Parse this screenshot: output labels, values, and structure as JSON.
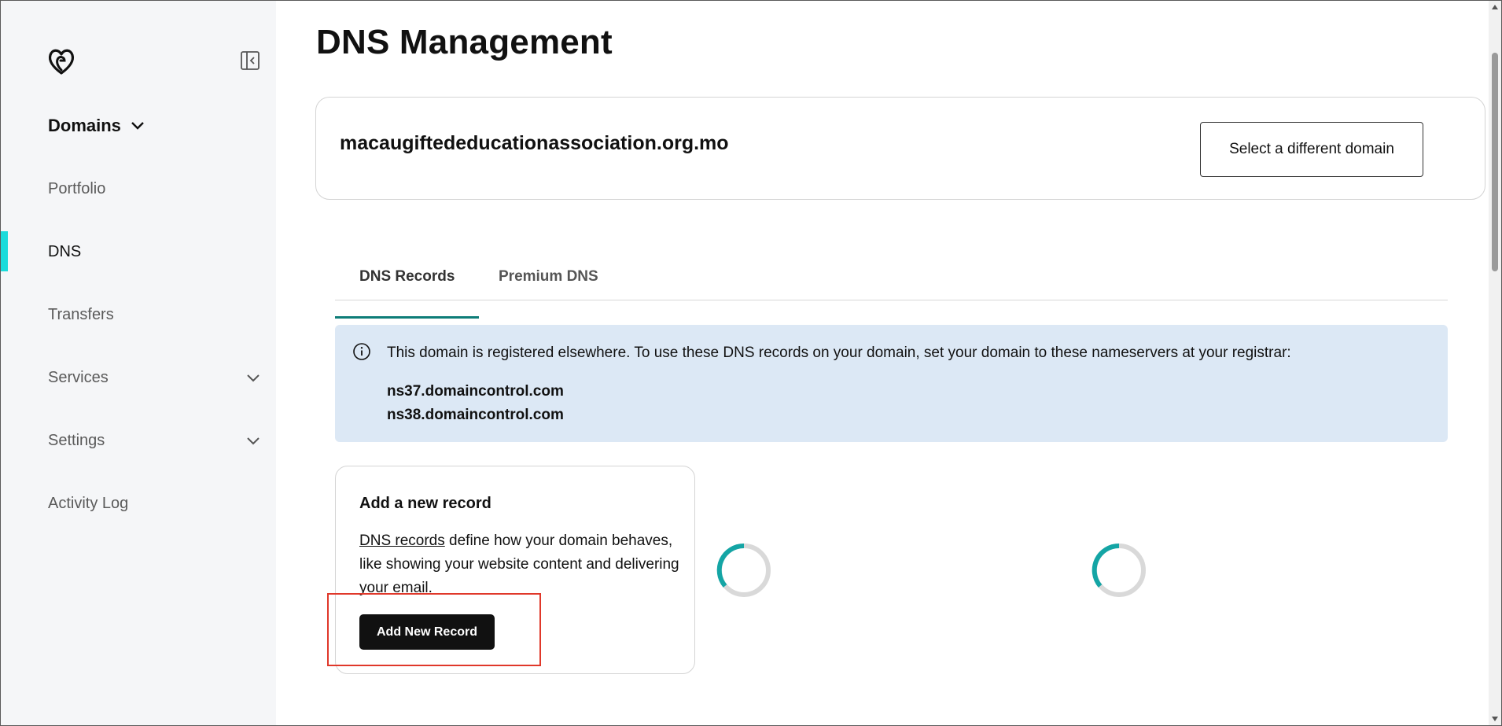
{
  "sidebar": {
    "logo_icon": "godaddy-logo-icon",
    "collapse_icon": "sidebar-collapse-icon",
    "section_label": "Domains",
    "items": [
      {
        "label": "Portfolio"
      },
      {
        "label": "DNS",
        "active": true
      },
      {
        "label": "Transfers"
      },
      {
        "label": "Services",
        "expandable": true
      },
      {
        "label": "Settings",
        "expandable": true
      },
      {
        "label": "Activity Log"
      }
    ],
    "active_color": "#1bdbdb"
  },
  "main": {
    "title": "DNS Management",
    "domain": {
      "name": "macaugiftededucationassociation.org.mo",
      "select_button_label": "Select a different domain"
    },
    "tabs": [
      {
        "label": "DNS Records",
        "active": true
      },
      {
        "label": "Premium DNS",
        "active": false
      }
    ],
    "notice": {
      "icon": "info-icon",
      "text": "This domain is registered elsewhere. To use these DNS records on your domain, set your domain to these nameservers at your registrar:",
      "nameservers": [
        "ns37.domaincontrol.com",
        "ns38.domaincontrol.com"
      ],
      "background": "#dce8f5"
    },
    "add_record": {
      "title": "Add a new record",
      "link_text": "DNS records",
      "description_rest": " define how your domain behaves, like showing your website content and delivering your email.",
      "button_label": "Add New Record"
    },
    "loading_spinners": 2,
    "accent_color": "#0e7d78",
    "spinner_color": "#14a5a5"
  }
}
